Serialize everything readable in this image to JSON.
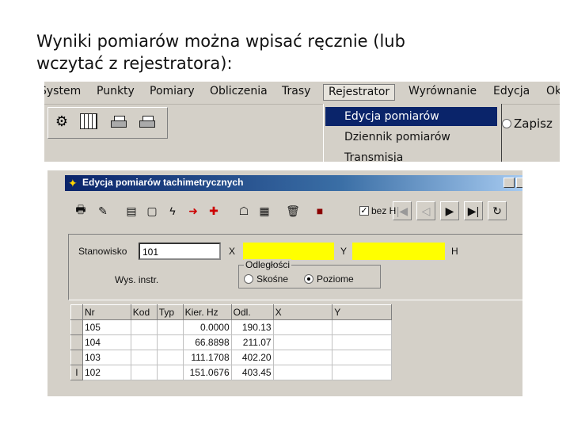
{
  "slide": {
    "title_line1": "Wyniki pomiarów  można wpisać ręcznie (lub",
    "title_line2": "wczytać z rejestratora):"
  },
  "menubar": {
    "items": [
      "System",
      "Punkty",
      "Pomiary",
      "Obliczenia",
      "Trasy",
      "Rejestrator",
      "Wyrównanie",
      "Edycja",
      "Ok"
    ],
    "active": "Rejestrator"
  },
  "toolbar1": {
    "icons": [
      "tools-icon",
      "table-icon",
      "printer-color-icon",
      "printer-icon"
    ]
  },
  "dropdown": {
    "items": [
      "Edycja pomiarów",
      "Dziennik pomiarów",
      "Transmisja"
    ],
    "selected_index": 0
  },
  "zapisz": {
    "label": "Zapisz"
  },
  "dialog": {
    "title": "Edycja pomiarów tachimetrycznych",
    "toolbar": {
      "checkbox_label": "bez H",
      "checkbox_checked": true
    },
    "form": {
      "stanowisko_label": "Stanowisko",
      "stanowisko_value": "101",
      "x_label": "X",
      "y_label": "Y",
      "h_label": "H",
      "wys_label": "Wys. instr.",
      "distance_group": "Odległości",
      "opt1": "Skośne",
      "opt2": "Poziome",
      "selected_option": "Poziome",
      "field_color": "#ffff00"
    },
    "grid": {
      "headers": [
        "Nr",
        "Kod",
        "Typ",
        "Kier. Hz",
        "Odl.",
        "X",
        "Y"
      ],
      "rows": [
        {
          "nr": "105",
          "kod": "",
          "typ": "",
          "hz": "0.0000",
          "odl": "190.13",
          "x": "",
          "y": "",
          "indicator": ""
        },
        {
          "nr": "104",
          "kod": "",
          "typ": "",
          "hz": "66.8898",
          "odl": "211.07",
          "x": "",
          "y": "",
          "indicator": ""
        },
        {
          "nr": "103",
          "kod": "",
          "typ": "",
          "hz": "111.1708",
          "odl": "402.20",
          "x": "",
          "y": "",
          "indicator": ""
        },
        {
          "nr": "102",
          "kod": "",
          "typ": "",
          "hz": "151.0676",
          "odl": "403.45",
          "x": "",
          "y": "",
          "indicator": "I"
        }
      ]
    }
  }
}
